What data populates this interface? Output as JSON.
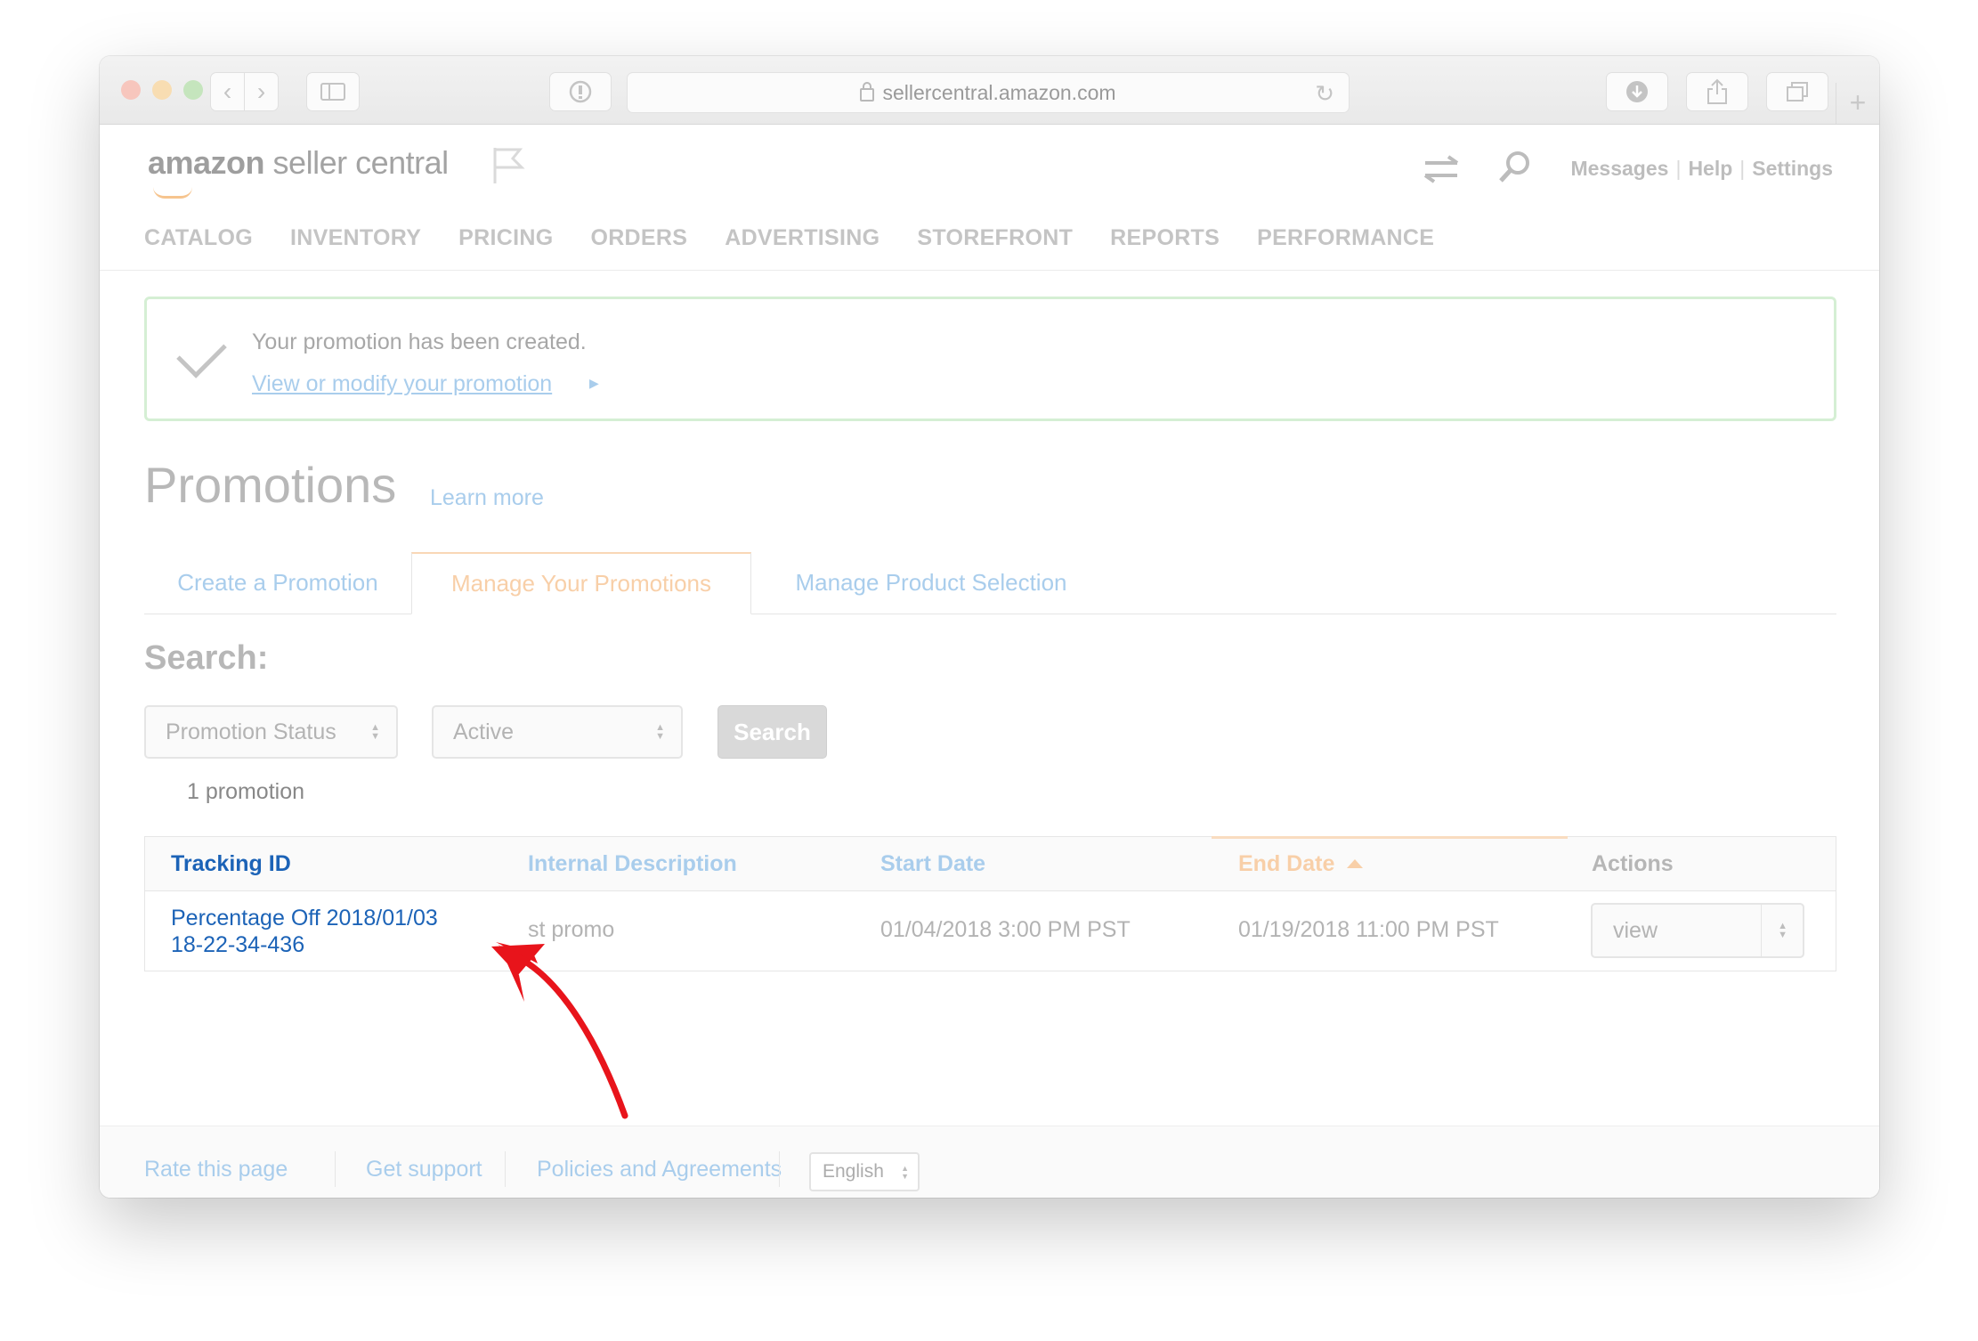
{
  "browser": {
    "url": "sellercentral.amazon.com"
  },
  "header": {
    "logo_brand": "amazon",
    "logo_suffix": " seller central",
    "links": [
      "Messages",
      "Help",
      "Settings"
    ]
  },
  "nav": [
    "CATALOG",
    "INVENTORY",
    "PRICING",
    "ORDERS",
    "ADVERTISING",
    "STOREFRONT",
    "REPORTS",
    "PERFORMANCE"
  ],
  "alert": {
    "message": "Your promotion has been created.",
    "link": "View or modify your promotion"
  },
  "page": {
    "title": "Promotions",
    "learn_more": "Learn more"
  },
  "tabs": {
    "create": "Create a Promotion",
    "manage": "Manage Your Promotions",
    "product": "Manage Product Selection"
  },
  "search": {
    "heading": "Search:",
    "filter_field": "Promotion Status",
    "filter_value": "Active",
    "button": "Search",
    "count": "1 promotion"
  },
  "table": {
    "headers": {
      "tracking": "Tracking ID",
      "description": "Internal Description",
      "start": "Start Date",
      "end": "End Date",
      "actions": "Actions"
    },
    "rows": [
      {
        "tracking_line1": "Percentage Off 2018/01/03",
        "tracking_line2": "18-22-34-436",
        "description": "st promo",
        "start": "01/04/2018 3:00 PM PST",
        "end": "01/19/2018 11:00 PM PST",
        "action": "view"
      }
    ]
  },
  "footer": {
    "rate": "Rate this page",
    "support": "Get support",
    "policies": "Policies and Agreements",
    "language": "English"
  },
  "colors": {
    "link_blue": "#1c63b7",
    "annotation_arrow": "#e8141b",
    "active_tab_accent": "#f8cfa8"
  }
}
